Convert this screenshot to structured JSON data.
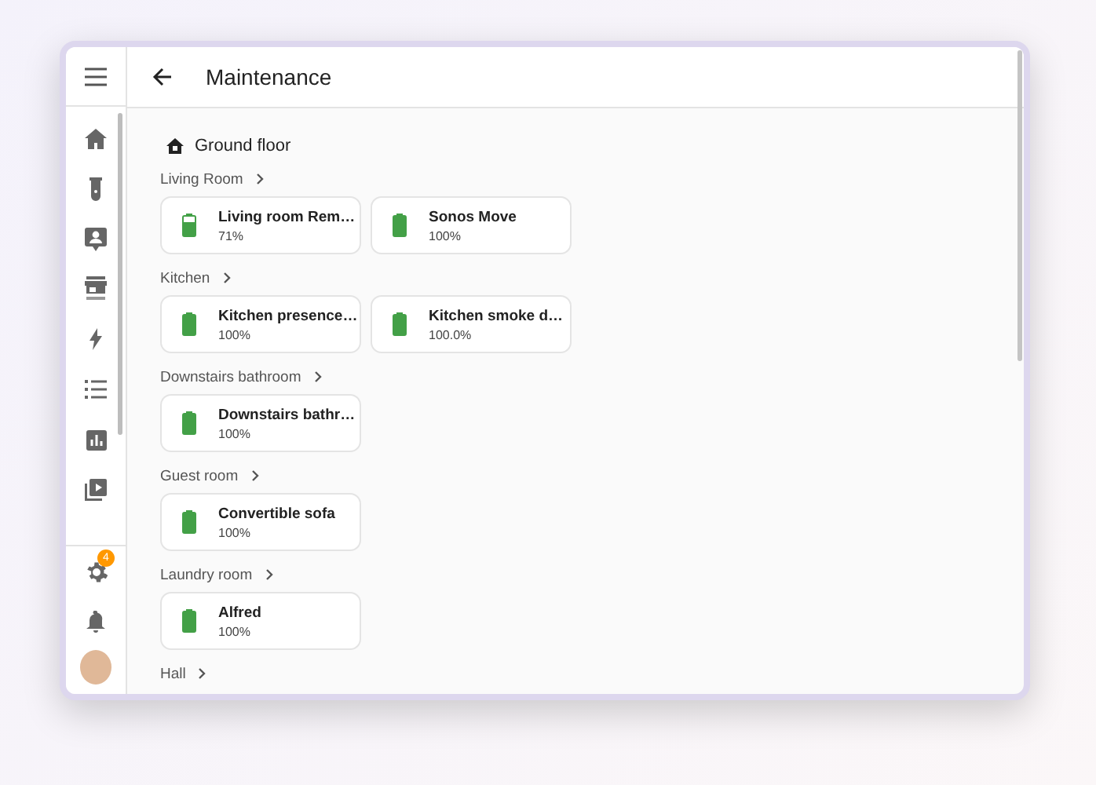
{
  "header": {
    "title": "Maintenance"
  },
  "sidebar": {
    "settings_badge": "4"
  },
  "floor": {
    "name": "Ground floor"
  },
  "areas": [
    {
      "name": "Living Room",
      "devices": [
        {
          "name": "Living room Rem…",
          "reading": "71%",
          "level": 0.71
        },
        {
          "name": "Sonos Move",
          "reading": "100%",
          "level": 1
        }
      ]
    },
    {
      "name": "Kitchen",
      "devices": [
        {
          "name": "Kitchen presence…",
          "reading": "100%",
          "level": 1
        },
        {
          "name": "Kitchen smoke d…",
          "reading": "100.0%",
          "level": 1
        }
      ]
    },
    {
      "name": "Downstairs bathroom",
      "devices": [
        {
          "name": "Downstairs bathr…",
          "reading": "100%",
          "level": 1
        }
      ]
    },
    {
      "name": "Guest room",
      "devices": [
        {
          "name": "Convertible sofa",
          "reading": "100%",
          "level": 1
        }
      ]
    },
    {
      "name": "Laundry room",
      "devices": [
        {
          "name": "Alfred",
          "reading": "100%",
          "level": 1
        }
      ]
    },
    {
      "name": "Hall"
    }
  ]
}
